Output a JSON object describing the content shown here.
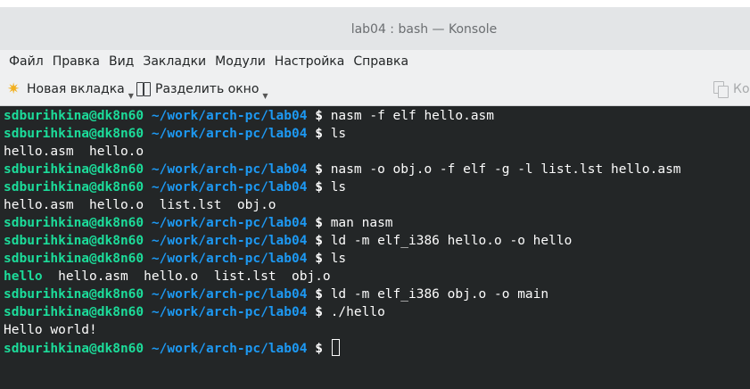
{
  "window": {
    "title": "lab04 : bash — Konsole"
  },
  "menubar": [
    "Файл",
    "Правка",
    "Вид",
    "Закладки",
    "Модули",
    "Настройка",
    "Справка"
  ],
  "toolbar": {
    "new_tab_label": "Новая вкладка",
    "split_label": "Разделить окно",
    "copy_label": "Ко"
  },
  "prompt": {
    "user": "sdburihkina@dk8n60",
    "path": "~/work/arch-pc/lab04",
    "symbol": "$"
  },
  "terminal": {
    "lines": [
      {
        "type": "cmd",
        "text": "nasm -f elf hello.asm"
      },
      {
        "type": "cmd",
        "text": "ls"
      },
      {
        "type": "out",
        "text": "hello.asm  hello.o"
      },
      {
        "type": "cmd",
        "text": "nasm -o obj.o -f elf -g -l list.lst hello.asm"
      },
      {
        "type": "cmd",
        "text": "ls"
      },
      {
        "type": "out",
        "text": "hello.asm  hello.o  list.lst  obj.o"
      },
      {
        "type": "cmd",
        "text": "man nasm"
      },
      {
        "type": "cmd",
        "text": "ld -m elf_i386 hello.o -o hello"
      },
      {
        "type": "cmd",
        "text": "ls"
      },
      {
        "type": "ls",
        "exec": "hello",
        "rest": "  hello.asm  hello.o  list.lst  obj.o"
      },
      {
        "type": "cmd",
        "text": "ld -m elf_i386 obj.o -o main"
      },
      {
        "type": "cmd",
        "text": "./hello"
      },
      {
        "type": "out",
        "text": "Hello world!"
      },
      {
        "type": "cursor",
        "text": ""
      }
    ]
  }
}
